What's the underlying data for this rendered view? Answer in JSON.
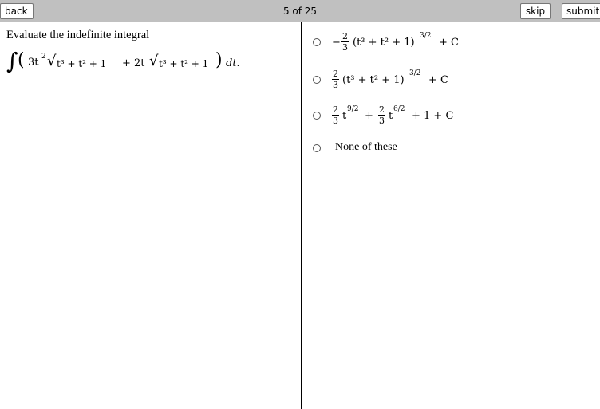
{
  "toolbar": {
    "back_label": "back",
    "progress": "5 of 25",
    "skip_label": "skip",
    "submit_label": "submit"
  },
  "question": {
    "prompt": "Evaluate the indefinite integral",
    "integral_symbol": "∫",
    "integrand_open": "(",
    "term1_coef": "3t",
    "term1_exp": "2",
    "radicand_1": "t³ + t² + 1",
    "plus_sep": "+",
    "term2_coef": "2t",
    "radicand_2": "t³ + t² + 1",
    "integrand_close": ")",
    "differential": "dt."
  },
  "options": [
    {
      "sign": "−",
      "frac_num": "2",
      "frac_den": "3",
      "body": "(t³ + t² + 1)",
      "exponent": "3/2",
      "tail": "+ C"
    },
    {
      "sign": "",
      "frac_num": "2",
      "frac_den": "3",
      "body": "(t³ + t² + 1)",
      "exponent": "3/2",
      "tail": "+ C"
    },
    {
      "frac1_num": "2",
      "frac1_den": "3",
      "term1_base": "t",
      "term1_exp": "9/2",
      "plus": "+",
      "frac2_num": "2",
      "frac2_den": "3",
      "term2_base": "t",
      "term2_exp": "6/2",
      "tail": "+ 1 + C"
    },
    {
      "label": "None of these"
    }
  ]
}
